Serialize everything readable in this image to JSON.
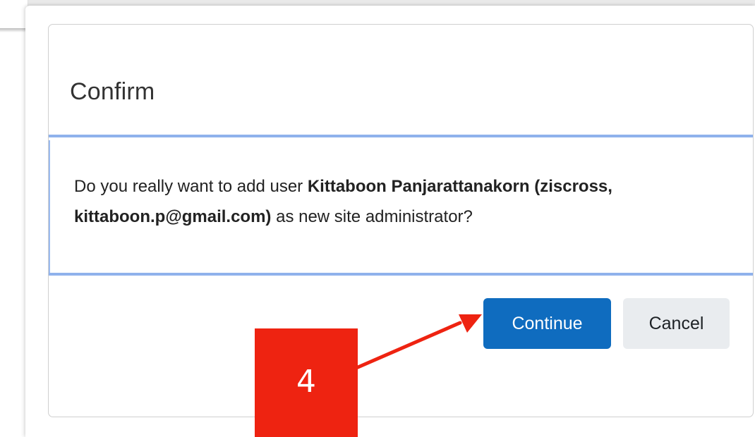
{
  "modal": {
    "title": "Confirm",
    "body": {
      "prefix": "Do you really want to add user ",
      "user_bold": "Kittaboon Panjarattanakorn (ziscross, kittaboon.p@gmail.com)",
      "suffix": " as new site administrator?"
    },
    "buttons": {
      "continue_label": "Continue",
      "cancel_label": "Cancel"
    }
  },
  "annotation": {
    "step_number": "4",
    "color": "#ee2311"
  },
  "colors": {
    "primary_button": "#0f6cbf",
    "secondary_button": "#e9ecef",
    "divider_accent": "#8fb2ec"
  }
}
